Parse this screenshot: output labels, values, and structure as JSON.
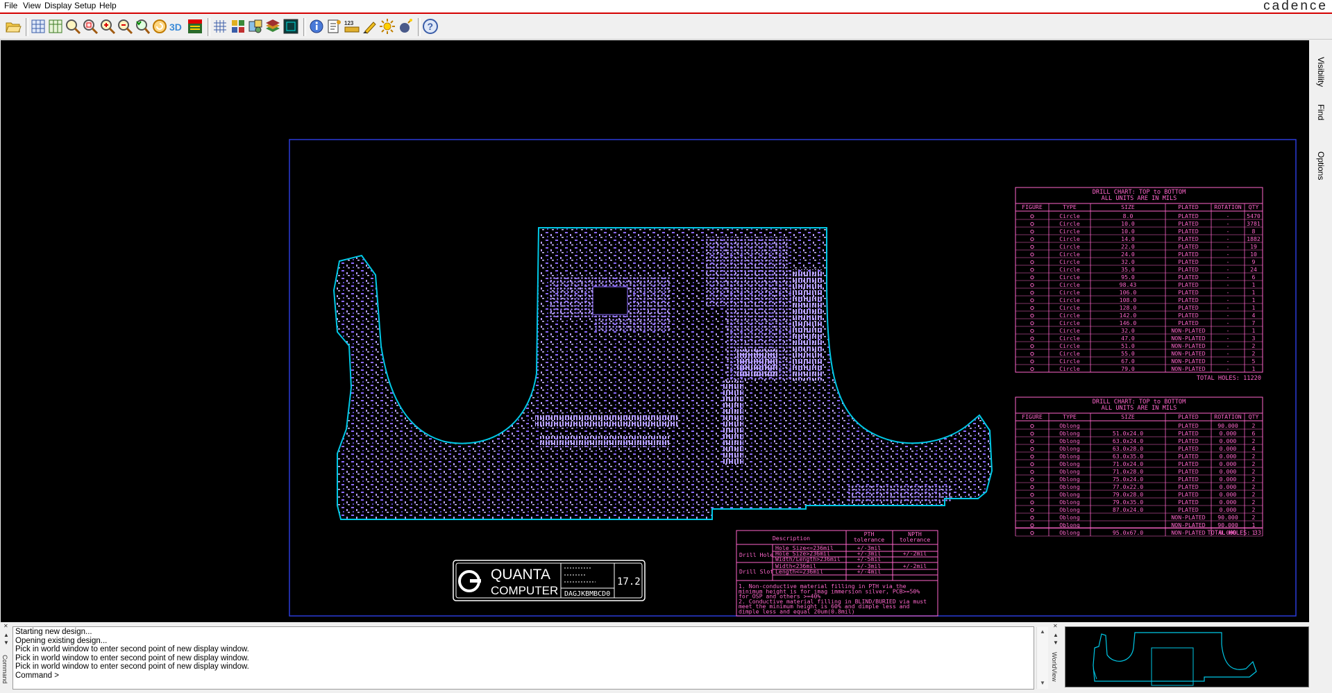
{
  "menu": {
    "items": [
      "File",
      "View",
      "Display",
      "Setup",
      "Help"
    ]
  },
  "brand": "cadence",
  "toolbar": {
    "icons": [
      "open-folder-icon",
      "grid-zoom-icon",
      "zoom-fit-icon",
      "zoom-points-icon",
      "zoom-area-icon",
      "zoom-in-icon",
      "zoom-out-icon",
      "zoom-previous-icon",
      "refresh-icon",
      "3d-view-icon",
      "flip-icon",
      "grid-icon",
      "color-layers-icon",
      "display-settings-icon",
      "stack-layers-icon",
      "world-view-icon",
      "info-icon",
      "report-icon",
      "measure-123-icon",
      "highlight-icon",
      "brightness-icon",
      "shadow-icon",
      "help-icon"
    ]
  },
  "panel_tabs": [
    "Visibility",
    "Find",
    "Options"
  ],
  "drill_chart_1": {
    "title": "DRILL CHART: TOP to BOTTOM",
    "subtitle": "ALL UNITS ARE IN MILS",
    "headers": [
      "FIGURE",
      "TYPE",
      "SIZE",
      "PLATED",
      "ROTATION",
      "QTY"
    ],
    "rows": [
      [
        "Circle",
        "8.0",
        "PLATED",
        "-",
        "5470"
      ],
      [
        "Circle",
        "10.0",
        "PLATED",
        "-",
        "3781"
      ],
      [
        "Circle",
        "10.0",
        "PLATED",
        "-",
        "8"
      ],
      [
        "Circle",
        "14.0",
        "PLATED",
        "-",
        "1882"
      ],
      [
        "Circle",
        "22.0",
        "PLATED",
        "-",
        "19"
      ],
      [
        "Circle",
        "24.0",
        "PLATED",
        "-",
        "10"
      ],
      [
        "Circle",
        "32.0",
        "PLATED",
        "-",
        "9"
      ],
      [
        "Circle",
        "35.0",
        "PLATED",
        "-",
        "24"
      ],
      [
        "Circle",
        "95.0",
        "PLATED",
        "-",
        "6"
      ],
      [
        "Circle",
        "98.43",
        "PLATED",
        "-",
        "1"
      ],
      [
        "Circle",
        "106.0",
        "PLATED",
        "-",
        "1"
      ],
      [
        "Circle",
        "108.0",
        "PLATED",
        "-",
        "1"
      ],
      [
        "Circle",
        "128.0",
        "PLATED",
        "-",
        "1"
      ],
      [
        "Circle",
        "142.0",
        "PLATED",
        "-",
        "4"
      ],
      [
        "Circle",
        "146.0",
        "PLATED",
        "-",
        "7"
      ],
      [
        "Circle",
        "32.0",
        "NON-PLATED",
        "-",
        "1"
      ],
      [
        "Circle",
        "47.0",
        "NON-PLATED",
        "-",
        "3"
      ],
      [
        "Circle",
        "51.0",
        "NON-PLATED",
        "-",
        "2"
      ],
      [
        "Circle",
        "55.0",
        "NON-PLATED",
        "-",
        "2"
      ],
      [
        "Circle",
        "67.0",
        "NON-PLATED",
        "-",
        "5"
      ],
      [
        "Circle",
        "79.0",
        "NON-PLATED",
        "-",
        "1"
      ]
    ],
    "total": "TOTAL HOLES: 11220"
  },
  "drill_chart_2": {
    "title": "DRILL CHART: TOP to BOTTOM",
    "subtitle": "ALL UNITS ARE IN MILS",
    "headers": [
      "FIGURE",
      "TYPE",
      "SIZE",
      "PLATED",
      "ROTATION",
      "QTY"
    ],
    "rows": [
      [
        "Oblong",
        "",
        "PLATED",
        "90.000",
        "2"
      ],
      [
        "Oblong",
        "51.0x24.0",
        "PLATED",
        "0.000",
        "6"
      ],
      [
        "Oblong",
        "63.0x24.0",
        "PLATED",
        "0.000",
        "2"
      ],
      [
        "Oblong",
        "63.0x28.0",
        "PLATED",
        "0.000",
        "4"
      ],
      [
        "Oblong",
        "63.0x35.0",
        "PLATED",
        "0.000",
        "2"
      ],
      [
        "Oblong",
        "71.0x24.0",
        "PLATED",
        "0.000",
        "2"
      ],
      [
        "Oblong",
        "71.0x28.0",
        "PLATED",
        "0.000",
        "2"
      ],
      [
        "Oblong",
        "75.0x24.0",
        "PLATED",
        "0.000",
        "2"
      ],
      [
        "Oblong",
        "77.0x22.0",
        "PLATED",
        "0.000",
        "2"
      ],
      [
        "Oblong",
        "79.0x28.0",
        "PLATED",
        "0.000",
        "2"
      ],
      [
        "Oblong",
        "79.0x35.0",
        "PLATED",
        "0.000",
        "2"
      ],
      [
        "Oblong",
        "87.0x24.0",
        "PLATED",
        "0.000",
        "2"
      ],
      [
        "Oblong",
        "",
        "NON-PLATED",
        "90.000",
        "2"
      ],
      [
        "Oblong",
        "",
        "NON-PLATED",
        "90.000",
        "1"
      ],
      [
        "Oblong",
        "95.0x67.0",
        "NON-PLATED",
        "0.000",
        "1"
      ]
    ],
    "total": "TOTAL HOLES: 33"
  },
  "tolerance": {
    "headers": [
      "Description",
      "PTH",
      "NPTH"
    ],
    "header_sub": "tolerance",
    "rows": [
      [
        "Drill Hole",
        "Hole Size<=236mil",
        "+/-3mil",
        ""
      ],
      [
        "",
        "Hole Size>236mil",
        "+/-3mil",
        "+/-2mil"
      ],
      [
        "Drill Slot",
        "Width/Length>236mil",
        "+/-5mil",
        ""
      ],
      [
        "",
        "Width<236mil",
        "+/-3mil",
        "+/-2mil"
      ],
      [
        "",
        "Length<=236mil",
        "+/-4mil",
        ""
      ]
    ],
    "notes": [
      "1. Non-conductive material filling in PTH via the",
      "minimum height is for imag immersion silver, PCB>=50%",
      "for OSP and others >=40%",
      "2. Conductive material filling in BLIND/BURIED via must",
      "meet the minimum height is 60% and dimple less and",
      "dimple less and equal 20um(0.8mil)"
    ]
  },
  "titleblock": {
    "company_line1": "QUANTA",
    "company_line2": "COMPUTER",
    "part_no": "DAGJKBMBCD0",
    "rev": "17.2"
  },
  "command": {
    "lines": [
      "Starting new design...",
      "Opening existing design...",
      "Pick in world window to enter second point of new display window.",
      "Pick in world window to enter second point of new display window.",
      "Pick in world window to enter second point of new display window.",
      "Command >"
    ]
  },
  "side_labels": {
    "command": "Command",
    "worldview": "WorldView"
  },
  "colors": {
    "board_outline": "#00c8e6",
    "components": "#9a7dff",
    "drill_text": "#ff66cc",
    "frame": "#2b3bd8",
    "menu_accent": "#d40000"
  }
}
